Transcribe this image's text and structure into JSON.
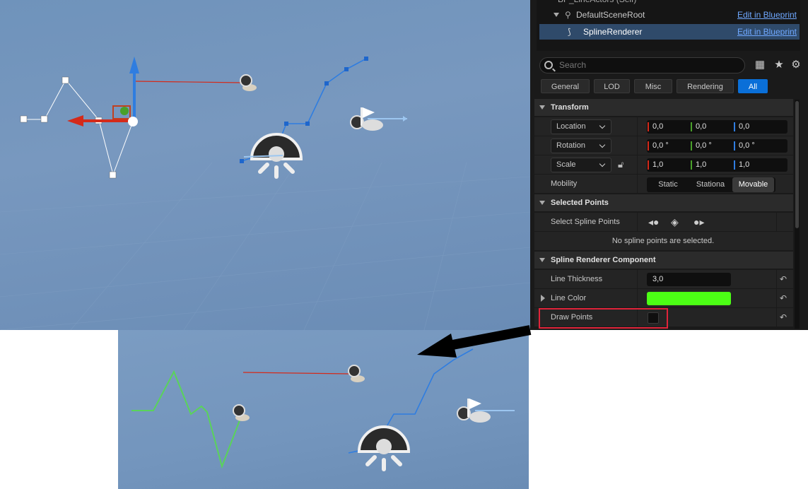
{
  "outliner": {
    "root_label": "BP_LineActors (Self)",
    "items": [
      {
        "label": "DefaultSceneRoot",
        "link": "Edit in Blueprint"
      },
      {
        "label": "SplineRenderer",
        "link": "Edit in Blueprint"
      }
    ]
  },
  "details": {
    "search_placeholder": "Search",
    "icons": [
      "table-icon",
      "star-icon",
      "settings-icon"
    ],
    "tabs": [
      "General",
      "LOD",
      "Misc",
      "Rendering",
      "All"
    ],
    "active_tab": "All",
    "transform": {
      "title": "Transform",
      "location": {
        "label": "Location",
        "x": "0,0",
        "y": "0,0",
        "z": "0,0"
      },
      "rotation": {
        "label": "Rotation",
        "x": "0,0 °",
        "y": "0,0 °",
        "z": "0,0 °"
      },
      "scale": {
        "label": "Scale",
        "x": "1,0",
        "y": "1,0",
        "z": "1,0"
      },
      "mobility": {
        "label": "Mobility",
        "options": [
          "Static",
          "Stationa",
          "Movable"
        ],
        "selected": "Movable"
      }
    },
    "selected_points": {
      "title": "Selected Points",
      "select_label": "Select Spline Points",
      "message": "No spline points are selected."
    },
    "spline_renderer": {
      "title": "Spline Renderer Component",
      "line_thickness": {
        "label": "Line Thickness",
        "value": "3,0"
      },
      "line_color": {
        "label": "Line Color",
        "color": "#4cff15"
      },
      "draw_points": {
        "label": "Draw Points",
        "checked": false
      }
    }
  },
  "colors": {
    "highlight": "#e0243a",
    "accent": "#0a6fd8",
    "spline_line": "#5ad35a",
    "x_axis": "#d42a1a",
    "y_axis": "#2f7de0",
    "z_axis": "#49a02a"
  }
}
